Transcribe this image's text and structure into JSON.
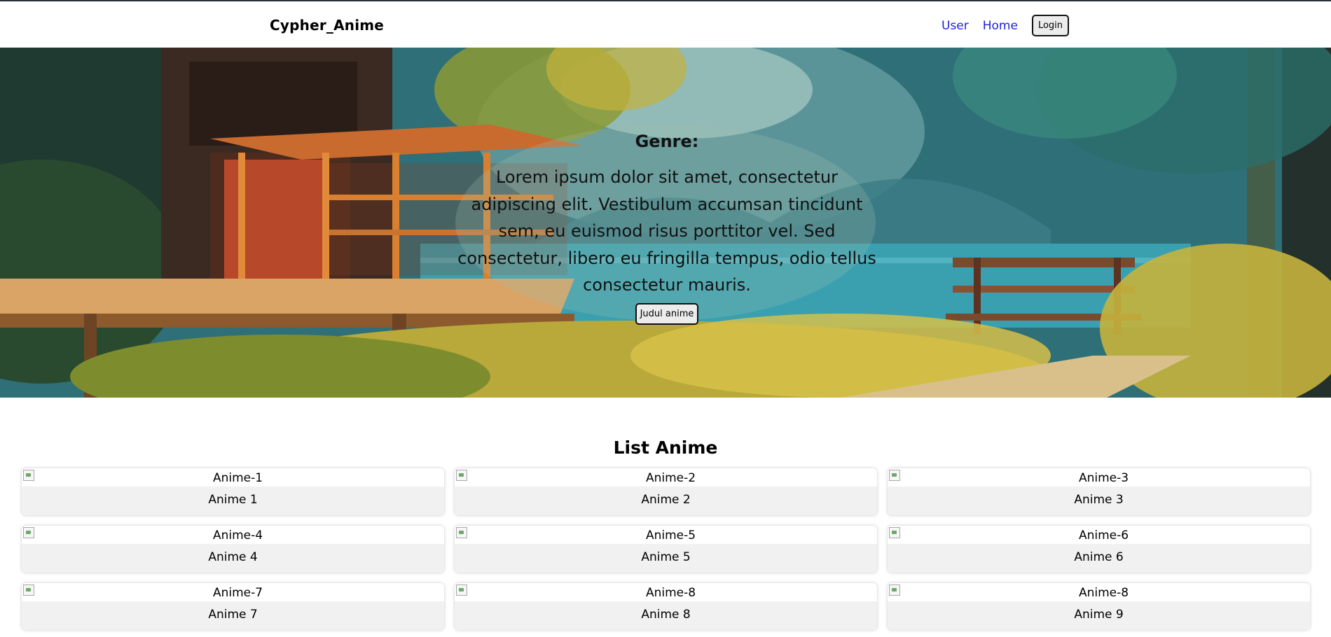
{
  "nav": {
    "brand": "Cypher_Anime",
    "links": [
      {
        "label": "User"
      },
      {
        "label": "Home"
      }
    ],
    "login_label": "Login",
    "link_color": "#1f1fd6"
  },
  "hero": {
    "heading": "Genre:",
    "description": "Lorem ipsum dolor sit amet, consectetur adipiscing elit. Vestibulum accumsan tincidunt sem, eu euismod risus porttitor vel. Sed consectetur, libero eu fringilla tempus, odio tellus consectetur mauris.",
    "button_label": "Judul anime"
  },
  "list": {
    "title": "List Anime",
    "items": [
      {
        "alt": "Anime-1",
        "label": "Anime 1"
      },
      {
        "alt": "Anime-2",
        "label": "Anime 2"
      },
      {
        "alt": "Anime-3",
        "label": "Anime 3"
      },
      {
        "alt": "Anime-4",
        "label": "Anime 4"
      },
      {
        "alt": "Anime-5",
        "label": "Anime 5"
      },
      {
        "alt": "Anime-6",
        "label": "Anime 6"
      },
      {
        "alt": "Anime-7",
        "label": "Anime 7"
      },
      {
        "alt": "Anime-8",
        "label": "Anime 8"
      },
      {
        "alt": "Anime-8",
        "label": "Anime 9"
      }
    ]
  }
}
